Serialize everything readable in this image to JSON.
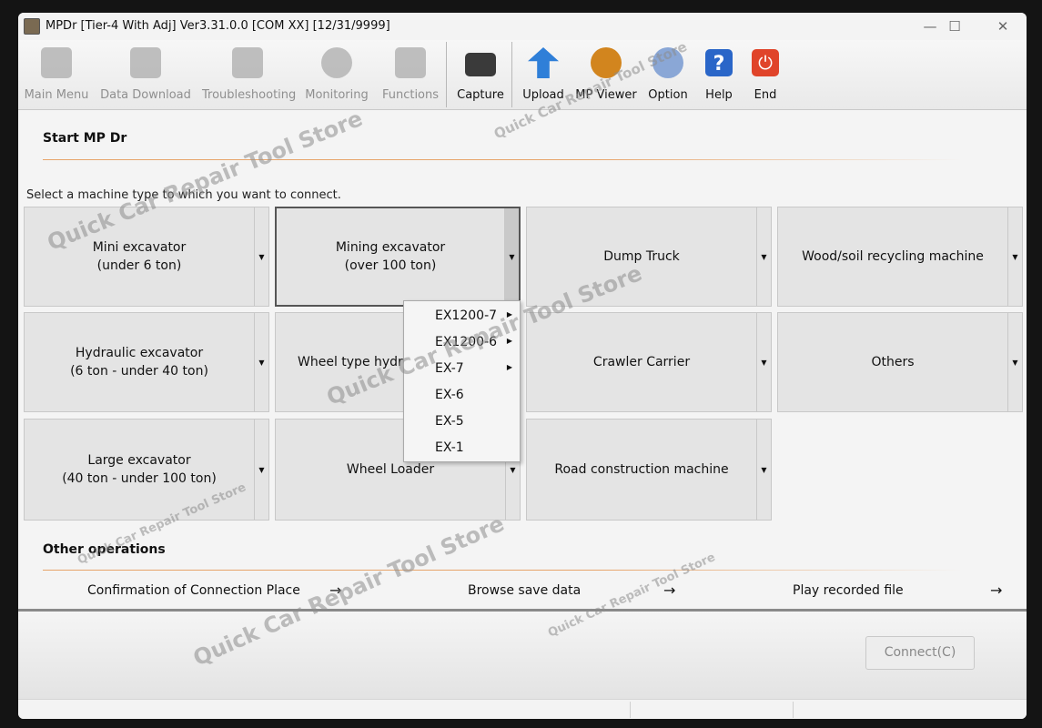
{
  "window": {
    "title": "MPDr [Tier-4 With Adj] Ver3.31.0.0 [COM XX] [12/31/9999]",
    "controls": {
      "minimize": "—",
      "maximize": "☐",
      "close": "✕"
    }
  },
  "toolbar": {
    "items": [
      {
        "label": "Main Menu",
        "icon": "main-menu-icon",
        "enabled": false,
        "color": "#9a9a9a"
      },
      {
        "label": "Data Download",
        "icon": "data-download-icon",
        "enabled": false,
        "color": "#9a9a9a"
      },
      {
        "label": "Troubleshooting",
        "icon": "stethoscope-icon",
        "enabled": false,
        "color": "#9a9a9a"
      },
      {
        "label": "Monitoring",
        "icon": "gauge-icon",
        "enabled": false,
        "color": "#9a9a9a"
      },
      {
        "label": "Functions",
        "icon": "gears-icon",
        "enabled": false,
        "color": "#9a9a9a"
      },
      {
        "label": "Capture",
        "icon": "camera-icon",
        "enabled": true,
        "color": "#3a3a3a"
      },
      {
        "label": "Upload",
        "icon": "upload-arrow-icon",
        "enabled": true,
        "color": "#2f7fd8"
      },
      {
        "label": "MP Viewer",
        "icon": "mp-viewer-icon",
        "enabled": true,
        "color": "#d2851e"
      },
      {
        "label": "Option",
        "icon": "option-gears-icon",
        "enabled": true,
        "color": "#8aa7d6"
      },
      {
        "label": "Help",
        "icon": "help-icon",
        "enabled": true,
        "color": "#2a66c8"
      },
      {
        "label": "End",
        "icon": "power-icon",
        "enabled": true,
        "color": "#e0442a"
      }
    ]
  },
  "start": {
    "title": "Start MP Dr",
    "instruction": "Select a machine type to which you want to connect.",
    "machines": [
      {
        "line1": "Mini excavator",
        "line2": "(under 6 ton)"
      },
      {
        "line1": "Mining excavator",
        "line2": "(over 100 ton)"
      },
      {
        "line1": "Dump Truck",
        "line2": ""
      },
      {
        "line1": "Wood/soil recycling machine",
        "line2": ""
      },
      {
        "line1": "Hydraulic excavator",
        "line2": "(6 ton - under 40 ton)"
      },
      {
        "line1": "Wheel type hydraulic excavator",
        "line2": ""
      },
      {
        "line1": "Crawler Carrier",
        "line2": ""
      },
      {
        "line1": "Others",
        "line2": ""
      },
      {
        "line1": "Large excavator",
        "line2": "(40 ton - under 100 ton)"
      },
      {
        "line1": "Wheel Loader",
        "line2": ""
      },
      {
        "line1": "Road construction machine",
        "line2": ""
      }
    ],
    "dropdown_glyph": "▼"
  },
  "mining_menu": {
    "items": [
      {
        "label": "EX1200-7",
        "submenu": "▶"
      },
      {
        "label": "EX1200-6",
        "submenu": "▶"
      },
      {
        "label": "EX-7",
        "submenu": "▶"
      },
      {
        "label": "EX-6",
        "submenu": ""
      },
      {
        "label": "EX-5",
        "submenu": ""
      },
      {
        "label": "EX-1",
        "submenu": ""
      }
    ]
  },
  "other": {
    "title": "Other operations",
    "ops": [
      {
        "label": "Confirmation of Connection Place",
        "arrow": "→"
      },
      {
        "label": "Browse save data",
        "arrow": "→"
      },
      {
        "label": "Play recorded file",
        "arrow": "→"
      }
    ]
  },
  "footer": {
    "connect_label": "Connect(C)"
  },
  "watermarks": [
    "Quick Car Repair Tool Store",
    "Quick Car Repair Tool Store",
    "Quick Car Repair Tool Store",
    "Quick Car Repair Tool Store",
    "Quick Car Repair Tool Store",
    "Quick Car Repair Tool Store"
  ]
}
